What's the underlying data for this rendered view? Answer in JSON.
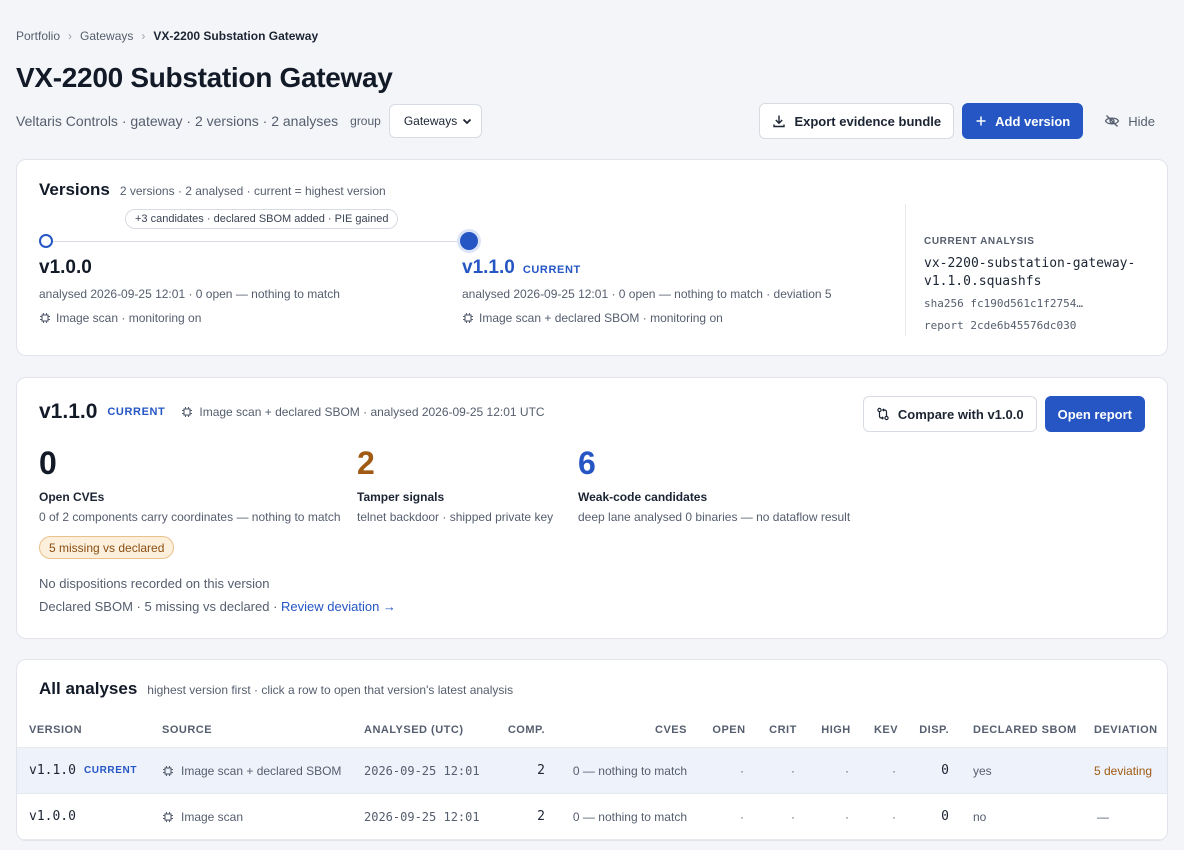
{
  "breadcrumb": {
    "items": [
      "Portfolio",
      "Gateways"
    ],
    "current": "VX-2200 Substation Gateway"
  },
  "page": {
    "title": "VX-2200 Substation Gateway",
    "subtitle": "Veltaris Controls · gateway · 2 versions · 2 analyses",
    "group_label": "group",
    "group_value": "Gateways"
  },
  "actions": {
    "export": "Export evidence bundle",
    "add_version": "Add version",
    "hide": "Hide"
  },
  "versions": {
    "title": "Versions",
    "subtitle": "2 versions · 2 analysed · current = highest version",
    "diff_pill": "+3 candidates · declared SBOM added · PIE gained",
    "items": [
      {
        "name": "v1.0.0",
        "tag": "",
        "meta": "analysed 2026-09-25 12:01 · 0 open — nothing to match",
        "source": "Image scan · monitoring on"
      },
      {
        "name": "v1.1.0",
        "tag": "CURRENT",
        "meta": "analysed 2026-09-25 12:01 · 0 open — nothing to match · deviation 5",
        "source": "Image scan + declared SBOM · monitoring on"
      }
    ],
    "current_analysis": {
      "label": "CURRENT ANALYSIS",
      "file": "vx-2200-substation-gateway-v1.1.0.squashfs",
      "sha": "sha256 fc190d561c1f2754…",
      "report": "report 2cde6b45576dc030"
    }
  },
  "detail": {
    "version": "v1.1.0",
    "tag": "CURRENT",
    "source": "Image scan + declared SBOM · analysed 2026-09-25 12:01 UTC",
    "compare": "Compare with v1.0.0",
    "open_report": "Open report",
    "metrics": [
      {
        "value": "0",
        "label": "Open CVEs",
        "sub": "0 of 2 components carry coordinates — nothing to match",
        "color": "#121a28"
      },
      {
        "value": "2",
        "label": "Tamper signals",
        "sub": "telnet backdoor · shipped private key",
        "color": "#a05a14"
      },
      {
        "value": "6",
        "label": "Weak-code candidates",
        "sub": "deep lane analysed 0 binaries — no dataflow result",
        "color": "#2556c4"
      }
    ],
    "warn_pill": "5 missing vs declared",
    "dispositions": "No dispositions recorded on this version",
    "declared_text": "Declared SBOM · 5 missing vs declared · ",
    "review_link": "Review deviation →"
  },
  "analyses": {
    "title": "All analyses",
    "subtitle": "highest version first · click a row to open that version's latest analysis",
    "headers": [
      "VERSION",
      "SOURCE",
      "ANALYSED (UTC)",
      "COMP.",
      "CVES",
      "OPEN",
      "CRIT",
      "HIGH",
      "KEV",
      "DISP.",
      "DECLARED SBOM",
      "DEVIATION"
    ],
    "rows": [
      {
        "version": "v1.1.0",
        "tag": "CURRENT",
        "source": "Image scan + declared SBOM",
        "analysed": "2026-09-25 12:01",
        "comp": "2",
        "cves": "0 — nothing to match",
        "open": "·",
        "crit": "·",
        "high": "·",
        "kev": "·",
        "disp": "0",
        "declared": "yes",
        "deviation": "5 deviating"
      },
      {
        "version": "v1.0.0",
        "tag": "",
        "source": "Image scan",
        "analysed": "2026-09-25 12:01",
        "comp": "2",
        "cves": "0 — nothing to match",
        "open": "·",
        "crit": "·",
        "high": "·",
        "kev": "·",
        "disp": "0",
        "declared": "no",
        "deviation": "—"
      }
    ]
  }
}
